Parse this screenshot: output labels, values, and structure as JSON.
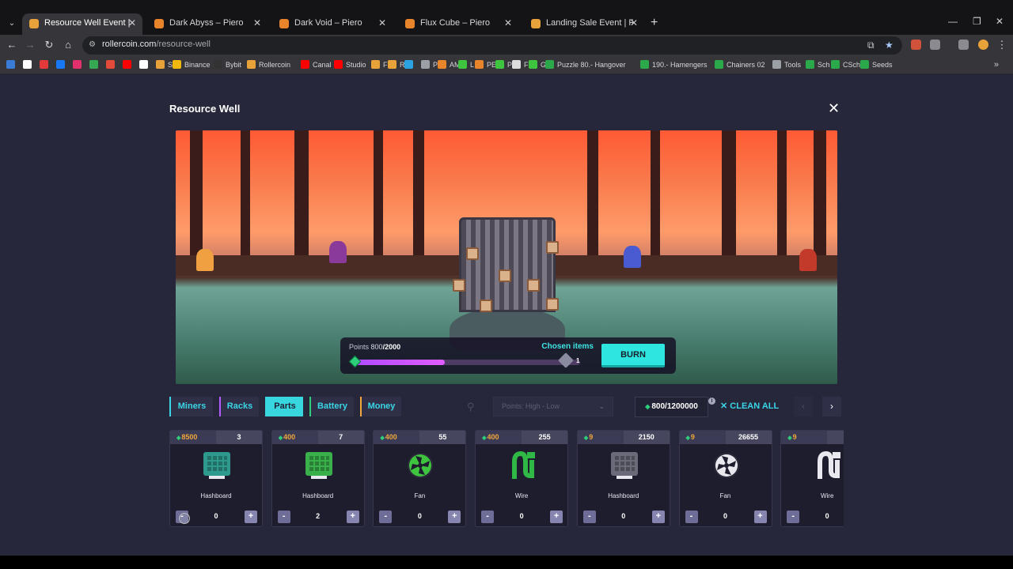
{
  "browser": {
    "tabs": [
      {
        "title": "Resource Well Event | RollerCoin",
        "active": true,
        "favicon_color": "#e8a23a"
      },
      {
        "title": "Dark Abyss – Piero",
        "active": false,
        "favicon_color": "#e8852a"
      },
      {
        "title": "Dark Void – Piero",
        "active": false,
        "favicon_color": "#e8852a"
      },
      {
        "title": "Flux Cube – Piero",
        "active": false,
        "favicon_color": "#e8852a"
      },
      {
        "title": "Landing Sale Event | RollerCoin",
        "active": false,
        "favicon_color": "#e8a23a"
      }
    ],
    "new_tab_label": "+",
    "url_host": "rollercoin.com",
    "url_path": "/resource-well",
    "bookmarks": [
      {
        "label": "",
        "color": "#3a7bd5"
      },
      {
        "label": "",
        "color": "#ffffff"
      },
      {
        "label": "",
        "color": "#e23a3a"
      },
      {
        "label": "",
        "color": "#1877f2"
      },
      {
        "label": "",
        "color": "#e1306c"
      },
      {
        "label": "",
        "color": "#34a853"
      },
      {
        "label": "",
        "color": "#e24a3a"
      },
      {
        "label": "",
        "color": "#ff0000"
      },
      {
        "label": "",
        "color": "#ffffff"
      },
      {
        "label": "S",
        "color": "#e8a23a"
      },
      {
        "label": "Binance",
        "color": "#f0b90b"
      },
      {
        "label": "Bybit",
        "color": "#333333"
      },
      {
        "label": "Rollercoin",
        "color": "#e8a23a"
      },
      {
        "label": "Canal",
        "color": "#ff0000"
      },
      {
        "label": "Studio",
        "color": "#ff0000"
      },
      {
        "label": "F",
        "color": "#e8a23a"
      },
      {
        "label": "R",
        "color": "#e8a23a"
      },
      {
        "label": "",
        "color": "#2aa3e0"
      },
      {
        "label": "P",
        "color": "#9aa0a6"
      },
      {
        "label": "AM",
        "color": "#e8852a"
      },
      {
        "label": "L",
        "color": "#3ec43e"
      },
      {
        "label": "PE",
        "color": "#e8852a"
      },
      {
        "label": "P",
        "color": "#3ec43e"
      },
      {
        "label": "F",
        "color": "#dddddd"
      },
      {
        "label": "G",
        "color": "#3ec43e"
      },
      {
        "label": "Puzzle 80.- Hangover",
        "color": "#2aa84a"
      },
      {
        "label": "190.- Hamengers",
        "color": "#2aa84a"
      },
      {
        "label": "Chainers 02",
        "color": "#2aa84a"
      },
      {
        "label": "Tools",
        "color": "#9aa0a6"
      },
      {
        "label": "Sch",
        "color": "#2aa84a"
      },
      {
        "label": "CSch",
        "color": "#2aa84a"
      },
      {
        "label": "Seeds",
        "color": "#2aa84a"
      }
    ]
  },
  "modal": {
    "title": "Resource Well",
    "close_label": "✕",
    "points_label": "Points",
    "points_current": "800",
    "points_max": "/2000",
    "progress_fraction": 0.4,
    "chosen_items_label": "Chosen items",
    "chosen_count": "1",
    "burn_label": "BURN"
  },
  "filters": {
    "tabs": [
      {
        "label": "Miners",
        "active": false,
        "accent": "#3ad6e6"
      },
      {
        "label": "Racks",
        "active": false,
        "accent": "#b45cff"
      },
      {
        "label": "Parts",
        "active": true,
        "accent": "#38d6de"
      },
      {
        "label": "Battery",
        "active": false,
        "accent": "#2dcf7a"
      },
      {
        "label": "Money",
        "active": false,
        "accent": "#f2a73b"
      }
    ],
    "sort_placeholder": "Points: High - Low",
    "points_total": "800/1200000",
    "clean_all_label": "CLEAN ALL",
    "prev_label": "‹",
    "next_label": "›"
  },
  "cards": [
    {
      "points": "8500",
      "qty": "3",
      "name": "Hashboard",
      "value": "0",
      "icon": "hashboard-teal-icon",
      "color": "#2e9a8e"
    },
    {
      "points": "400",
      "qty": "7",
      "name": "Hashboard",
      "value": "2",
      "icon": "hashboard-green-icon",
      "color": "#3ab04a"
    },
    {
      "points": "400",
      "qty": "55",
      "name": "Fan",
      "value": "0",
      "icon": "fan-green-icon",
      "color": "#3ec43e"
    },
    {
      "points": "400",
      "qty": "255",
      "name": "Wire",
      "value": "0",
      "icon": "wire-green-icon",
      "color": "#2fb845"
    },
    {
      "points": "9",
      "qty": "2150",
      "name": "Hashboard",
      "value": "0",
      "icon": "hashboard-gray-icon",
      "color": "#6a6a78"
    },
    {
      "points": "9",
      "qty": "26655",
      "name": "Fan",
      "value": "0",
      "icon": "fan-white-icon",
      "color": "#e8e8ee"
    },
    {
      "points": "9",
      "qty": "",
      "name": "Wire",
      "value": "0",
      "icon": "wire-white-icon",
      "color": "#e8e8ee"
    }
  ]
}
